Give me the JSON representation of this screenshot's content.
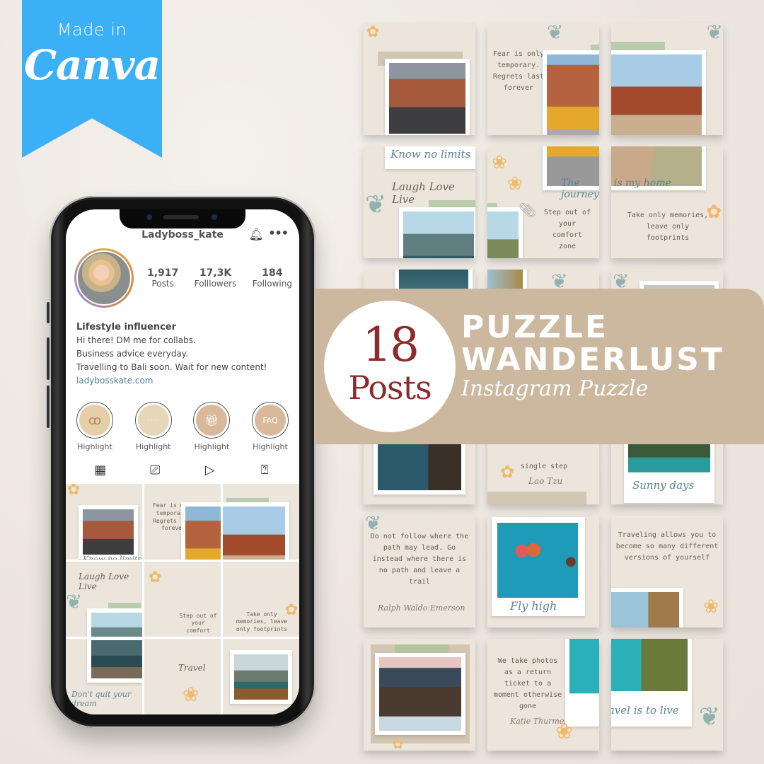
{
  "badge": {
    "line1": "Made in",
    "brand": "Canva",
    "color": "#3cb0f7"
  },
  "phone": {
    "username": "Ladyboss_kate",
    "icons": {
      "bell": "bell-icon",
      "more": "more-icon"
    },
    "bell_glyph": "🔔︎",
    "more_glyph": "•••",
    "stats": [
      {
        "value": "1,917",
        "label": "Posts"
      },
      {
        "value": "17,3K",
        "label": "Folllowers"
      },
      {
        "value": "184",
        "label": "Following"
      }
    ],
    "bio": {
      "name": "Lifestyle influencer",
      "lines": [
        "Hi there! DM me for collabs.",
        "Business advice everyday.",
        "Travelling to Bali soon. Wait for new content!"
      ],
      "link": "ladybosskate.com"
    },
    "highlights": [
      {
        "label": "Highlight",
        "glyph": "ꝏ",
        "color": "#e4cfa9"
      },
      {
        "label": "Highlight",
        "glyph": "· · · ·",
        "color": "#e8d6b8"
      },
      {
        "label": "Highlight",
        "glyph": "🎁︎",
        "color": "#d9b99b"
      },
      {
        "label": "Highlight",
        "glyph": "FAQ",
        "color": "#d9b99b"
      }
    ],
    "tabs": [
      {
        "name": "grid-icon",
        "glyph": "▦"
      },
      {
        "name": "reels-icon",
        "glyph": "⎚"
      },
      {
        "name": "video-icon",
        "glyph": "▷"
      },
      {
        "name": "tagged-icon",
        "glyph": "⍰"
      }
    ],
    "feed": [
      {
        "script": "Know no limits"
      },
      {
        "quote": "Fear is only temporary. Regrets last forever",
        "script": "Laugh Love Live"
      },
      {
        "script": "The journey is my home"
      },
      {
        "script": "Laugh Love Live"
      },
      {
        "quote": "Step out of your comfort zone"
      },
      {
        "quote": "Take only memories, leave only footprints"
      },
      {
        "script": "Don't quit your dream"
      },
      {
        "script": "Travel"
      },
      {
        "script": ""
      }
    ]
  },
  "banner": {
    "count": "18",
    "count_label": "Posts",
    "title_line1": "PUZZLE",
    "title_line2": "WANDERLUST",
    "subtitle": "Instagram Puzzle",
    "color": "#cbb89e",
    "count_color": "#8b2c2c"
  },
  "grid": [
    {
      "script": ""
    },
    {
      "quote": "Fear is only temporary. Regrets last forever"
    },
    {
      "script": ""
    },
    {
      "script": "Know no limits",
      "script2": "Laugh Love Live"
    },
    {
      "script": "The journey",
      "quote": "Step out of your comfort zone"
    },
    {
      "script": "is my home",
      "quote": "Take only memories, leave only footprints"
    },
    {
      "script": ""
    },
    {
      "script": ""
    },
    {
      "script": ""
    },
    {
      "script": ""
    },
    {
      "quote": "single step",
      "script": "Lao Tzu"
    },
    {
      "script": "Sunny days"
    },
    {
      "quote": "Do not follow where the path may lead. Go instead where there is no path and leave a trail",
      "script": "Ralph Waldo Emerson"
    },
    {
      "script": "Fly high"
    },
    {
      "quote": "Traveling allows you to become so many different versions of yourself"
    },
    {
      "script": ""
    },
    {
      "quote": "We take photos as a return ticket to a moment otherwise gone",
      "script": "Katie Thurmes"
    },
    {
      "script": "To travel is to live"
    }
  ]
}
